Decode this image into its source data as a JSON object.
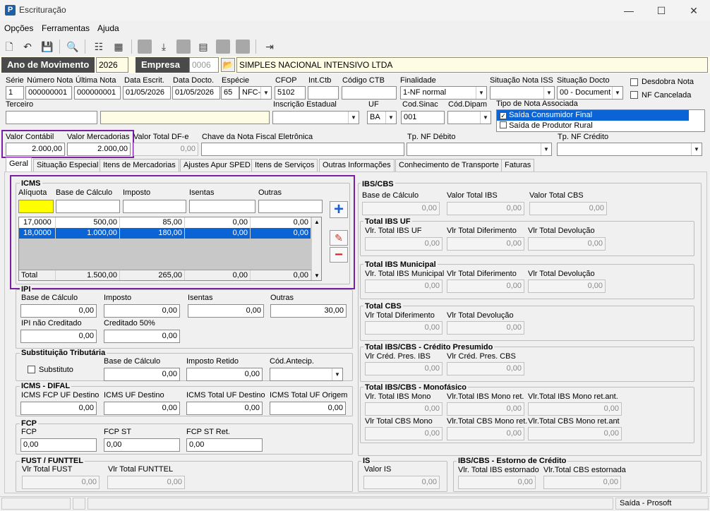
{
  "window": {
    "title": "Escrituração",
    "minimize": "—",
    "maximize": "☐",
    "close": "✕"
  },
  "menu": [
    "Opções",
    "Ferramentas",
    "Ajuda"
  ],
  "header": {
    "ano_label": "Ano de Movimento",
    "ano_value": "2026",
    "empresa_label": "Empresa",
    "empresa_code": "0006",
    "empresa_name": "SIMPLES NACIONAL INTENSIVO LTDA"
  },
  "row1": {
    "serie_label": "Série",
    "serie": "1",
    "numero_label": "Número Nota",
    "numero": "000000001",
    "ultima_label": "Última Nota",
    "ultima": "000000001",
    "data_escrit_label": "Data Escrit.",
    "data_escrit": "01/05/2026",
    "data_docto_label": "Data Docto.",
    "data_docto": "01/05/2026",
    "especie_label": "Espécie",
    "especie_code": "65",
    "especie_text": "NFC-I",
    "cfop_label": "CFOP",
    "cfop": "5102",
    "intctb_label": "Int.Ctb",
    "codctb_label": "Código CTB",
    "finalidade_label": "Finalidade",
    "finalidade": "1-NF normal",
    "sitiss_label": "Situação Nota ISS",
    "sitdocto_label": "Situação Docto",
    "sitdocto": "00 - Document",
    "desdobra_label": "Desdobra Nota",
    "cancelada_label": "NF Cancelada"
  },
  "row2": {
    "terceiro_label": "Terceiro",
    "ie_label": "Inscrição Estadual",
    "uf_label": "UF",
    "uf": "BA",
    "codsinac_label": "Cod.Sinac",
    "codsinac": "001",
    "coddipam_label": "Cód.Dipam",
    "tiponota_label": "Tipo de Nota Associada",
    "tiponota_opt1": "Saída Consumidor Final",
    "tiponota_opt2": "Saída de Produtor Rural"
  },
  "row3": {
    "vcontabil_label": "Valor Contábil",
    "vcontabil": "2.000,00",
    "vmerc_label": "Valor Mercadorias",
    "vmerc": "2.000,00",
    "vdfe_label": "Valor Total DF-e",
    "vdfe": "0,00",
    "chave_label": "Chave da Nota Fiscal Eletrônica",
    "tpdeb_label": "Tp. NF Débito",
    "tpcred_label": "Tp. NF Crédito"
  },
  "tabs": [
    "Geral",
    "Situação Especial",
    "Itens de Mercadorias",
    "Ajustes Apur SPED",
    "Itens de Serviços",
    "Outras Informações",
    "Conhecimento de Transporte",
    "Faturas"
  ],
  "icms": {
    "title": "ICMS",
    "cols": [
      "Alíquota",
      "Base de Cálculo",
      "Imposto",
      "Isentas",
      "Outras"
    ],
    "rows": [
      [
        "17,0000",
        "500,00",
        "85,00",
        "0,00",
        "0,00"
      ],
      [
        "18,0000",
        "1.000,00",
        "180,00",
        "0,00",
        "0,00"
      ]
    ],
    "total": [
      "Total",
      "1.500,00",
      "265,00",
      "0,00",
      "0,00"
    ]
  },
  "ipi": {
    "title": "IPI",
    "base_label": "Base de Cálculo",
    "base": "0,00",
    "imposto_label": "Imposto",
    "imposto": "0,00",
    "isentas_label": "Isentas",
    "isentas": "0,00",
    "outras_label": "Outras",
    "outras": "30,00",
    "naocred_label": "IPI não Creditado",
    "naocred": "0,00",
    "cred50_label": "Creditado 50%",
    "cred50": "0,00"
  },
  "st": {
    "title": "Substituição Tributária",
    "substituto_label": "Substituto",
    "base_label": "Base de Cálculo",
    "base": "0,00",
    "retido_label": "Imposto Retido",
    "retido": "0,00",
    "antecip_label": "Cód.Antecip."
  },
  "difal": {
    "title": "ICMS - DIFAL",
    "fcp_label": "ICMS FCP UF Destino",
    "fcp": "0,00",
    "ufdest_label": "ICMS UF Destino",
    "ufdest": "0,00",
    "totdest_label": "ICMS Total UF Destino",
    "totdest": "0,00",
    "totorig_label": "ICMS Total UF Origem",
    "totorig": "0,00"
  },
  "fcp": {
    "title": "FCP",
    "fcp_label": "FCP",
    "fcp": "0,00",
    "fcpst_label": "FCP ST",
    "fcpst": "0,00",
    "fcpstret_label": "FCP ST Ret.",
    "fcpstret": "0,00"
  },
  "fust": {
    "title": "FUST / FUNTTEL",
    "fust_label": "Vlr Total FUST",
    "fust": "0,00",
    "funttel_label": "Vlr Total FUNTTEL",
    "funttel": "0,00"
  },
  "ibscbs": {
    "title": "IBS/CBS",
    "base_label": "Base de Cálculo",
    "base": "0,00",
    "ibs_label": "Valor Total IBS",
    "ibs": "0,00",
    "cbs_label": "Valor Total CBS",
    "cbs": "0,00"
  },
  "ibsuf": {
    "title": "Total IBS UF",
    "a_label": "Vlr. Total IBS UF",
    "a": "0,00",
    "b_label": "Vlr Total Diferimento",
    "b": "0,00",
    "c_label": "Vlr Total Devolução",
    "c": "0,00"
  },
  "ibsmun": {
    "title": "Total IBS Municipal",
    "a_label": "Vlr. Total IBS Municipal",
    "a": "0,00",
    "b_label": "Vlr Total Diferimento",
    "b": "0,00",
    "c_label": "Vlr Total Devolução",
    "c": "0,00"
  },
  "cbs": {
    "title": "Total CBS",
    "a_label": "Vlr Total Diferimento",
    "a": "0,00",
    "b_label": "Vlr Total Devolução",
    "b": "0,00"
  },
  "credpres": {
    "title": "Total IBS/CBS - Crédito Presumido",
    "a_label": "Vlr Créd. Pres. IBS",
    "a": "0,00",
    "b_label": "Vlr Créd. Pres. CBS",
    "b": "0,00"
  },
  "mono": {
    "title": "Total IBS/CBS - Monofásico",
    "a_label": "Vlr. Total IBS Mono",
    "a": "0,00",
    "b_label": "Vlr.Total IBS Mono ret.",
    "b": "0,00",
    "c_label": "Vlr.Total IBS Mono ret.ant.",
    "c": "0,00",
    "d_label": "Vlr Total CBS Mono",
    "d": "0,00",
    "e_label": "Vlr.Total CBS Mono ret.",
    "e": "0,00",
    "f_label": "Vlr.Total CBS Mono ret.ant",
    "f": "0,00"
  },
  "is": {
    "title": "IS",
    "a_label": "Valor IS",
    "a": "0,00"
  },
  "estorno": {
    "title": "IBS/CBS - Estorno de Crédito",
    "a_label": "Vlr. Total IBS estornado",
    "a": "0,00",
    "b_label": "Vlr.Total CBS estornada",
    "b": "0,00"
  },
  "status": {
    "text": "Saída - Prosoft"
  }
}
